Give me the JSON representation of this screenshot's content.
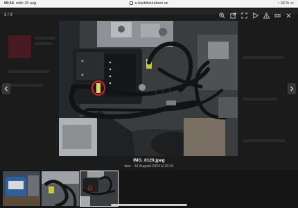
{
  "status": {
    "time": "09:16",
    "date": "mån 26 aug.",
    "url": "a.husbilsklubben.se",
    "battery": "33 %"
  },
  "viewer": {
    "counter": "3 / 3",
    "toolbar": [
      "zoom-in-icon",
      "open-external-icon",
      "fullscreen-icon",
      "slideshow-icon",
      "warning-icon",
      "grid-icon",
      "close-icon"
    ]
  },
  "image": {
    "filename": "IMG_0120.jpeg",
    "meta": "lanc · 10 Augusti 2024 kl 20:01"
  },
  "thumbnails": [
    "thumbnail-1",
    "thumbnail-2",
    "thumbnail-3"
  ],
  "colors": {
    "background": "#0d0d0d",
    "highlight_circle": "#d21f2b"
  }
}
